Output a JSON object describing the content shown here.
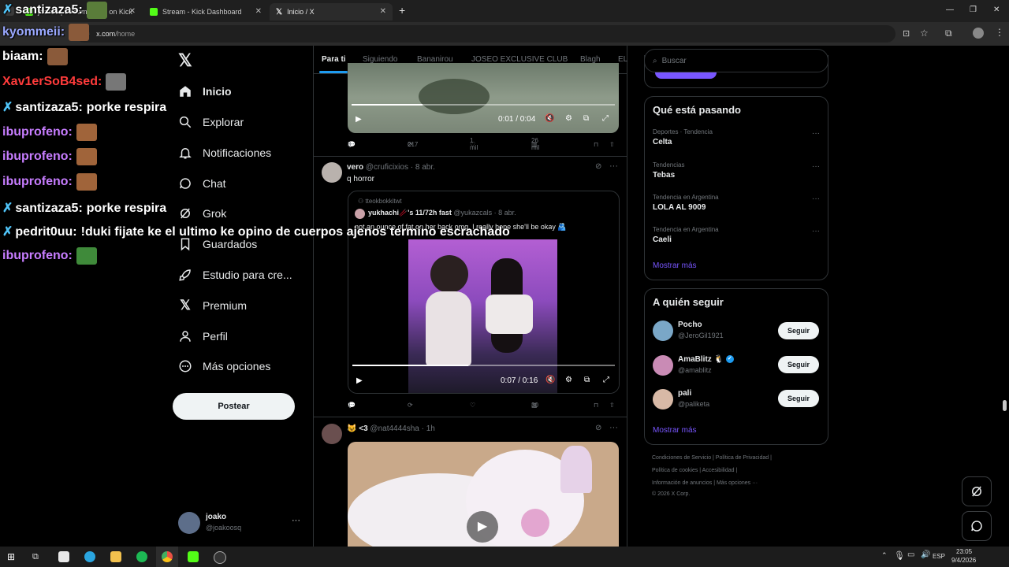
{
  "browser": {
    "tabs": [
      {
        "title": "joakosq Stream - Vive on Kick",
        "color": "#53fc18",
        "active": false
      },
      {
        "title": "Stream - Kick Dashboard",
        "color": "#53fc18",
        "active": false
      },
      {
        "title": "Inicio / X",
        "color": "#ffffff",
        "active": true
      }
    ],
    "new_tab": "+",
    "url_host": "x.com",
    "url_path": "/home"
  },
  "sidebar": {
    "items": [
      {
        "label": "Inicio",
        "icon": "home-icon"
      },
      {
        "label": "Explorar",
        "icon": "search-icon"
      },
      {
        "label": "Notificaciones",
        "icon": "bell-icon"
      },
      {
        "label": "Chat",
        "icon": "chat-icon"
      },
      {
        "label": "Grok",
        "icon": "grok-icon"
      },
      {
        "label": "Guardados",
        "icon": "bookmark-icon"
      },
      {
        "label": "Estudio para cre...",
        "icon": "rocket-icon"
      },
      {
        "label": "Premium",
        "icon": "x-logo-icon"
      },
      {
        "label": "Perfil",
        "icon": "person-icon"
      },
      {
        "label": "Más opciones",
        "icon": "more-circle-icon"
      }
    ],
    "post_button": "Postear",
    "account": {
      "name": "joako",
      "handle": "@joakoosq",
      "more": "···"
    }
  },
  "feed": {
    "tabs": [
      "Para ti",
      "Siguiendo",
      "Bananirou",
      "JOSEO EXCLUSIVE CLUB",
      "Blagh",
      "EL"
    ],
    "post1": {
      "video_time": "0:01 / 0:04",
      "replies": "8",
      "reposts": "217",
      "likes": "1 mil",
      "views": "26 mil",
      "progress": 0.27
    },
    "post2": {
      "name": "vero",
      "handle": "@cruficixios",
      "time": "8 abr.",
      "text": "q horror",
      "quote_context": "tteokbokkitwt",
      "quote_name": "yukhachi🥢's 11/72h fast",
      "quote_handle": "@yukazcals",
      "quote_time": "8 abr.",
      "quote_text": "not an ounce of fat on her back omg, I really hope she'll be okay 🫂",
      "video_time": "0:07 / 0:16",
      "replies": "1",
      "views": "30",
      "progress": 0.44
    },
    "post3": {
      "name": "😺 <3",
      "handle": "@nat4444sha",
      "time": "1h"
    }
  },
  "right": {
    "search_placeholder": "Buscar",
    "trends_title": "Qué está pasando",
    "trends": [
      {
        "category": "Deportes · Tendencia",
        "name": "Celta"
      },
      {
        "category": "Tendencias",
        "name": "Tebas"
      },
      {
        "category": "Tendencia en Argentina",
        "name": "LOLA AL 9009"
      },
      {
        "category": "Tendencia en Argentina",
        "name": "Caeli"
      }
    ],
    "show_more": "Mostrar más",
    "follow_title": "A quién seguir",
    "follow": [
      {
        "name": "Pocho",
        "handle": "@JeroGil1921",
        "button": "Seguir",
        "avatar_color": "#7aa7c7"
      },
      {
        "name": "AmaBlitz 🐧",
        "handle": "@amablitz",
        "button": "Seguir",
        "avatar_color": "#c98bb5"
      },
      {
        "name": "pali",
        "handle": "@paliketa",
        "button": "Seguir",
        "avatar_color": "#d8b9a6"
      }
    ],
    "follow_more": "Mostrar más",
    "footer": [
      "Condiciones de Servicio  |  Política de Privacidad  |",
      "Política de cookies  |  Accesibilidad  |",
      "Información de anuncios  |  Más opciones ···",
      "© 2026 X Corp."
    ]
  },
  "chat": [
    {
      "user": "santizaza5:",
      "color": "#ffffff",
      "msg": "",
      "badge": true,
      "emote": "#5a7d3a"
    },
    {
      "user": "kyommeii:",
      "color": "#9aa8ff",
      "msg": "",
      "badge": false,
      "emote": "#8a5a3a"
    },
    {
      "user": "biaam:",
      "color": "#ffffff",
      "msg": "",
      "badge": false,
      "emote": "#8a5a3a"
    },
    {
      "user": "Xav1erSoB4sed:",
      "color": "#ff3b3b",
      "msg": "",
      "badge": false,
      "emote": "#777777"
    },
    {
      "user": "santizaza5:",
      "color": "#ffffff",
      "msg": "porke respira",
      "badge": true,
      "emote": ""
    },
    {
      "user": "ibuprofeno:",
      "color": "#c77dff",
      "msg": "",
      "badge": false,
      "emote": "#a0643a"
    },
    {
      "user": "ibuprofeno:",
      "color": "#c77dff",
      "msg": "",
      "badge": false,
      "emote": "#a0643a"
    },
    {
      "user": "ibuprofeno:",
      "color": "#c77dff",
      "msg": "",
      "badge": false,
      "emote": "#a0643a"
    },
    {
      "user": "santizaza5:",
      "color": "#ffffff",
      "msg": "porke respira",
      "badge": true,
      "emote": ""
    },
    {
      "user": "pedrit0uu:",
      "color": "#ffffff",
      "msg": "!duki fijate ke el ultimo ke opino de cuerpos ajenos termino escrachado",
      "badge": true,
      "emote": ""
    },
    {
      "user": "ibuprofeno:",
      "color": "#c77dff",
      "msg": "",
      "badge": false,
      "emote": "#3f8a3a"
    }
  ],
  "taskbar": {
    "lang": "ESP",
    "time": "23:05",
    "date": "9/4/2026"
  },
  "colors": {
    "accent": "#1d9bf0",
    "purple": "#7856ff",
    "bg": "#000000",
    "border": "#2f3336"
  }
}
